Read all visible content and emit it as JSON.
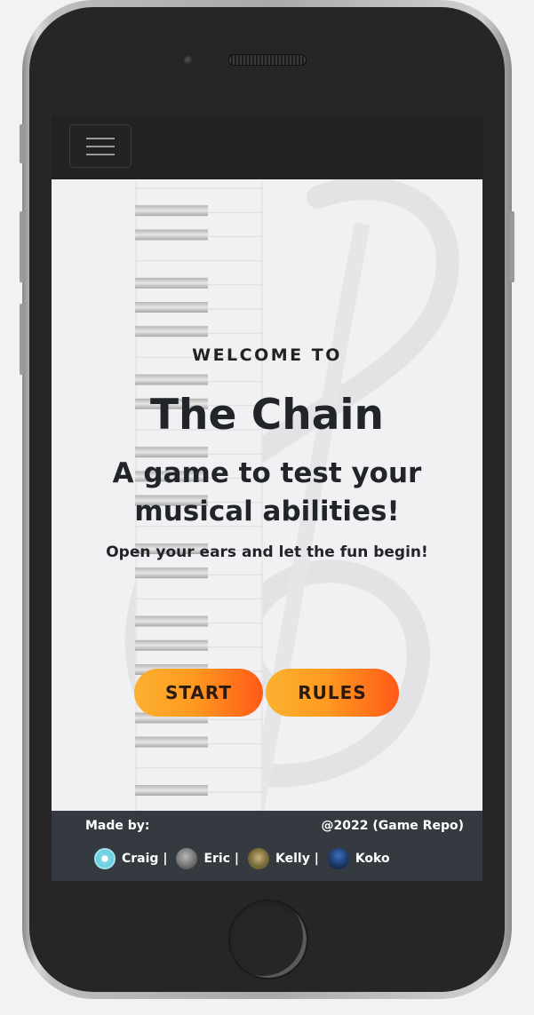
{
  "navbar": {
    "menu_icon": "hamburger-icon"
  },
  "hero": {
    "welcome": "WELCOME TO",
    "title": "The Chain",
    "subtitle": "A game to test your musical abilities!",
    "tagline": "Open your ears and let the fun begin!",
    "start_label": "START",
    "rules_label": "RULES"
  },
  "footer": {
    "made_by": "Made by:",
    "copyright": "@2022 (Game Repo)",
    "credits": [
      {
        "name": "Craig |",
        "avatar": "craig-avatar"
      },
      {
        "name": "Eric |",
        "avatar": "eric-avatar"
      },
      {
        "name": "Kelly |",
        "avatar": "kelly-avatar"
      },
      {
        "name": "Koko",
        "avatar": "koko-avatar"
      }
    ]
  },
  "colors": {
    "navbar_bg": "#222222",
    "footer_bg": "#343a40",
    "button_gradient_start": "#fbb131",
    "button_gradient_end": "#ff5a19",
    "text_dark": "#212529"
  }
}
